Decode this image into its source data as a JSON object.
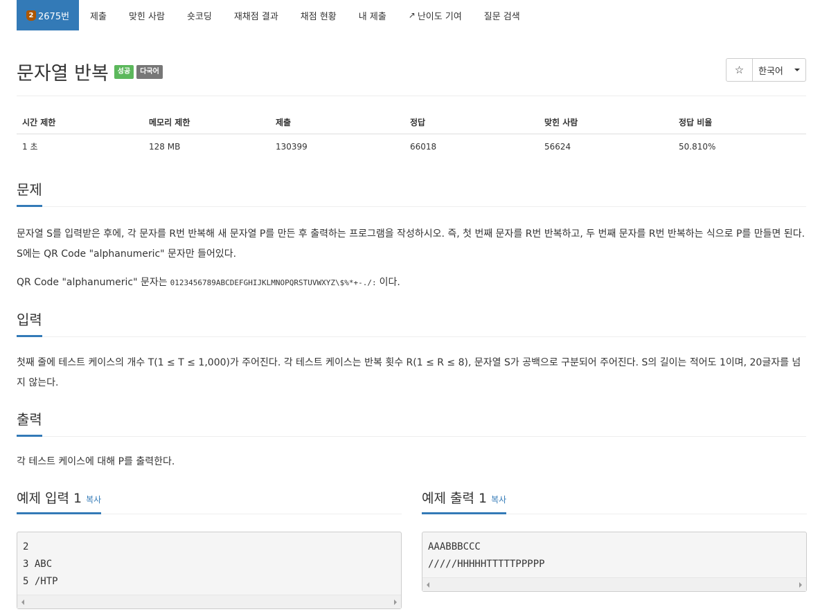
{
  "nav": {
    "problem_tab": {
      "tier": "2",
      "label": "2675번"
    },
    "tabs": [
      "제출",
      "맞힌 사람",
      "숏코딩",
      "재채점 결과",
      "채점 현황",
      "내 제출",
      "난이도 기여",
      "질문 검색"
    ]
  },
  "problem": {
    "title": "문자열 반복",
    "badge_success": "성공",
    "badge_multi": "다국어",
    "star_icon": "☆",
    "language": "한국어"
  },
  "info_table": {
    "headers": [
      "시간 제한",
      "메모리 제한",
      "제출",
      "정답",
      "맞힌 사람",
      "정답 비율"
    ],
    "values": [
      "1 초",
      "128 MB",
      "130399",
      "66018",
      "56624",
      "50.810%"
    ]
  },
  "sections": {
    "problem_title": "문제",
    "problem_text_1": "문자열 S를 입력받은 후에, 각 문자를 R번 반복해 새 문자열 P를 만든 후 출력하는 프로그램을 작성하시오. 즉, 첫 번째 문자를 R번 반복하고, 두 번째 문자를 R번 반복하는 식으로 P를 만들면 된다. S에는 QR Code \"alphanumeric\" 문자만 들어있다.",
    "problem_text_2_prefix": "QR Code \"alphanumeric\" 문자는",
    "problem_text_2_code": "0123456789ABCDEFGHIJKLMNOPQRSTUVWXYZ\\$%*+-./:",
    "problem_text_2_suffix": "이다.",
    "input_title": "입력",
    "input_text": "첫째 줄에 테스트 케이스의 개수 T(1 ≤ T ≤ 1,000)가 주어진다. 각 테스트 케이스는 반복 횟수 R(1 ≤ R ≤ 8), 문자열 S가 공백으로 구분되어 주어진다. S의 길이는 적어도 1이며, 20글자를 넘지 않는다.",
    "output_title": "출력",
    "output_text": "각 테스트 케이스에 대해 P를 출력한다."
  },
  "samples": {
    "input_title": "예제 입력 1",
    "output_title": "예제 출력 1",
    "copy_label": "복사",
    "input_lines": [
      "2",
      "3 ABC",
      "5 /HTP"
    ],
    "output_lines": [
      "AAABBBCCC",
      "/////HHHHHTTTTTPPPPP"
    ]
  }
}
